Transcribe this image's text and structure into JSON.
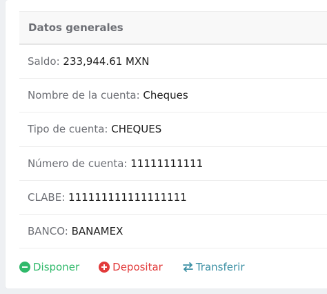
{
  "section": {
    "title": "Datos generales"
  },
  "details": [
    {
      "label": "Saldo: ",
      "value": "233,944.61 MXN"
    },
    {
      "label": "Nombre de la cuenta: ",
      "value": "Cheques"
    },
    {
      "label": "Tipo de cuenta: ",
      "value": "CHEQUES"
    },
    {
      "label": "Número de cuenta: ",
      "value": "11111111111"
    },
    {
      "label": "CLABE: ",
      "value": "111111111111111111"
    },
    {
      "label": "BANCO: ",
      "value": "BANAMEX"
    }
  ],
  "actions": {
    "dispose": {
      "label": "Disponer",
      "icon": "minus-circle-icon",
      "color": "#2fb96a"
    },
    "deposit": {
      "label": "Depositar",
      "icon": "plus-circle-icon",
      "color": "#e23a3a"
    },
    "transfer": {
      "label": "Transferir",
      "icon": "exchange-arrows-icon",
      "color": "#3a8fa3"
    }
  }
}
